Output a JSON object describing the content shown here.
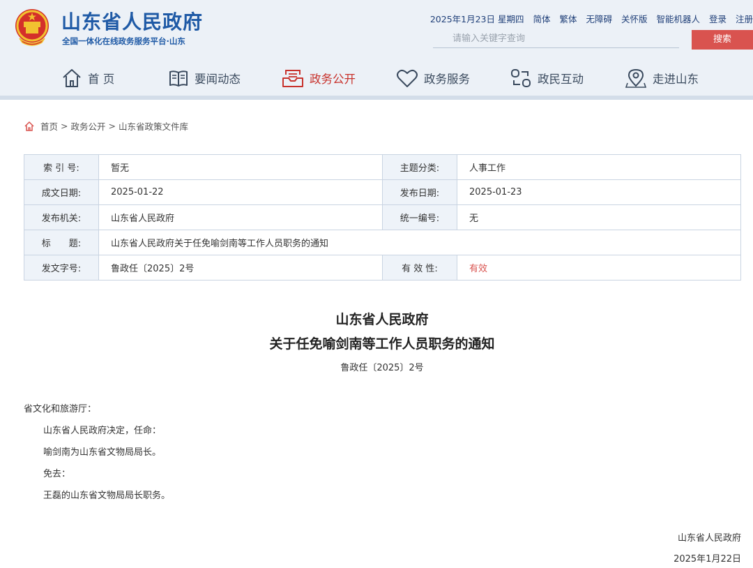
{
  "header": {
    "site_title": "山东省人民政府",
    "site_subtitle": "全国一体化在线政务服务平台·山东",
    "date": "2025年1月23日 星期四",
    "links": [
      "简体",
      "繁体",
      "无障碍",
      "关怀版",
      "智能机器人",
      "登录",
      "注册"
    ],
    "search_placeholder": "请输入关键字查询",
    "search_button": "搜索"
  },
  "nav": [
    {
      "label": "首 页",
      "icon": "home-icon"
    },
    {
      "label": "要闻动态",
      "icon": "book-icon"
    },
    {
      "label": "政务公开",
      "icon": "inbox-icon",
      "active": true
    },
    {
      "label": "政务服务",
      "icon": "heart-icon"
    },
    {
      "label": "政民互动",
      "icon": "interaction-icon"
    },
    {
      "label": "走进山东",
      "icon": "map-pin-icon"
    }
  ],
  "breadcrumb": [
    "首页",
    "政务公开",
    "山东省政策文件库"
  ],
  "meta": {
    "index_label": "索 引 号:",
    "index_value": "暂无",
    "topic_label": "主题分类:",
    "topic_value": "人事工作",
    "created_label": "成文日期:",
    "created_value": "2025-01-22",
    "published_label": "发布日期:",
    "published_value": "2025-01-23",
    "issuer_label": "发布机关:",
    "issuer_value": "山东省人民政府",
    "code_label": "统一编号:",
    "code_value": "无",
    "title_label": "标　　题:",
    "title_value": "山东省人民政府关于任免喻剑南等工作人员职务的通知",
    "docno_label": "发文字号:",
    "docno_value": "鲁政任〔2025〕2号",
    "validity_label": "有 效 性:",
    "validity_value": "有效"
  },
  "document": {
    "title_line1": "山东省人民政府",
    "title_line2": "关于任免喻剑南等工作人员职务的通知",
    "doc_number": "鲁政任〔2025〕2号",
    "recipient": "省文化和旅游厅：",
    "paragraphs": [
      "山东省人民政府决定，任命：",
      "喻剑南为山东省文物局局长。",
      "免去：",
      "王磊的山东省文物局局长职务。"
    ],
    "signer": "山东省人民政府",
    "sign_date": "2025年1月22日"
  },
  "colors": {
    "brand_blue": "#1f5aa6",
    "accent_red": "#d9534f",
    "header_bg": "#ecf1f7"
  }
}
